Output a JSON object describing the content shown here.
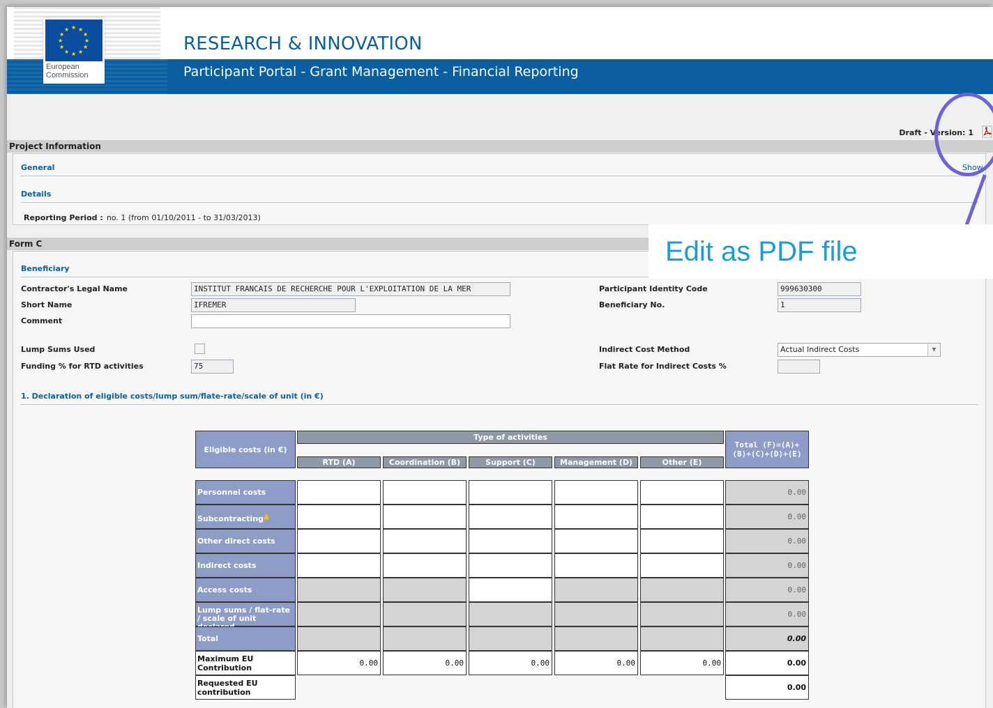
{
  "header": {
    "logo_line1": "European",
    "logo_line2": "Commission",
    "title": "RESEARCH & INNOVATION",
    "subtitle": "Participant Portal - Grant Management - Financial Reporting"
  },
  "toolbar": {
    "draft_version": "Draft - Version: 1",
    "pdf_icon": "pdf-icon"
  },
  "project_information": {
    "title": "Project Information",
    "general_label": "General",
    "show_label": "Show",
    "details_label": "Details",
    "reporting_period_label": "Reporting Period :",
    "reporting_period_value": "no. 1 (from 01/10/2011 - to 31/03/2013)"
  },
  "form_c": {
    "title": "Form C",
    "beneficiary_label": "Beneficiary",
    "fields": {
      "legal_name_label": "Contractor's Legal Name",
      "legal_name_value": "INSTITUT FRANCAIS DE RECHERCHE POUR L'EXPLOITATION DE LA MER",
      "short_name_label": "Short Name",
      "short_name_value": "IFREMER",
      "comment_label": "Comment",
      "comment_value": "",
      "lump_sums_label": "Lump Sums Used",
      "funding_label": "Funding % for RTD activities",
      "funding_value": "75",
      "pic_label": "Participant Identity Code",
      "pic_value": "999630300",
      "beneficiary_no_label": "Beneficiary No.",
      "beneficiary_no_value": "1",
      "indirect_method_label": "Indirect Cost Method",
      "indirect_method_value": "Actual Indirect Costs",
      "flat_rate_label": "Flat Rate for Indirect Costs %",
      "flat_rate_value": ""
    },
    "declaration_title": "1.  Declaration of eligible costs/lump sum/flate-rate/scale of unit (in €)"
  },
  "cost_table": {
    "eligible_header": "Eligible costs (in €)",
    "type_header": "Type of activities",
    "total_header": "Total (F)=(A)+(B)+(C)+(D)+(E)",
    "columns": [
      "RTD (A)",
      "Coordination (B)",
      "Support (C)",
      "Management (D)",
      "Other (E)"
    ],
    "rows": [
      {
        "label": "Personnel costs",
        "total": "0.00"
      },
      {
        "label": "Subcontracting",
        "total": "0.00"
      },
      {
        "label": "Other direct costs",
        "total": "0.00"
      },
      {
        "label": "Indirect costs",
        "total": "0.00"
      },
      {
        "label": "Access costs",
        "total": "0.00"
      },
      {
        "label": "Lump sums / flat-rate / scale of unit declared",
        "total": "0.00"
      },
      {
        "label": "Total",
        "total": "0.00"
      }
    ],
    "max_eu": {
      "label": "Maximum EU Contribution",
      "values": [
        "0.00",
        "0.00",
        "0.00",
        "0.00",
        "0.00"
      ],
      "total": "0.00"
    },
    "requested_eu": {
      "label": "Requested EU contribution",
      "total": "0.00"
    }
  },
  "callout": {
    "text": "Edit as PDF file"
  }
}
